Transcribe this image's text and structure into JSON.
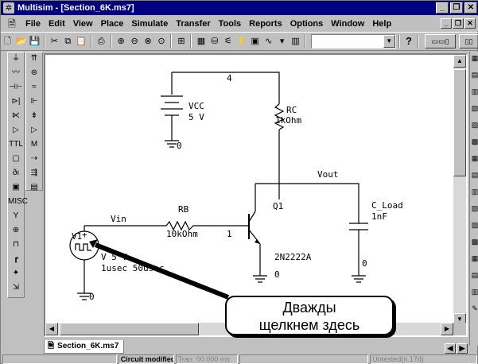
{
  "window": {
    "title": "Multisim - [Section_6K.ms7]"
  },
  "menu": [
    "File",
    "Edit",
    "View",
    "Place",
    "Simulate",
    "Transfer",
    "Tools",
    "Reports",
    "Options",
    "Window",
    "Help"
  ],
  "toolbar": {
    "combo_value": "",
    "help_label": "?"
  },
  "circuit": {
    "node_top": "4",
    "node_base": "1",
    "vcc_label": "VCC",
    "vcc_value": "5 V",
    "vcc_ground_node": "0",
    "rc_label": "RC",
    "rc_value": "1kOhm",
    "vout_label": "Vout",
    "q1_label": "Q1",
    "q1_model": "2N2222A",
    "q1_ground_node": "0",
    "cload_label": "C_Load",
    "cload_value": "1nF",
    "cload_ground_node": "0",
    "vin_label": "Vin",
    "rb_label": "RB",
    "rb_value": "10kOhm",
    "v1_label": "V1",
    "v1_value": "V 5 V",
    "v1_timing": "1usec 50usec",
    "v1_ground_node": "0"
  },
  "callout": {
    "line1": "Дважды",
    "line2": "щелкнем здесь"
  },
  "tabs": {
    "active_tab": "Section_6K.ms7"
  },
  "status": {
    "panel2": "Circuit modified",
    "panel3": "Tran: 00.000 ms",
    "panel5": "Untested(n.17d)"
  }
}
